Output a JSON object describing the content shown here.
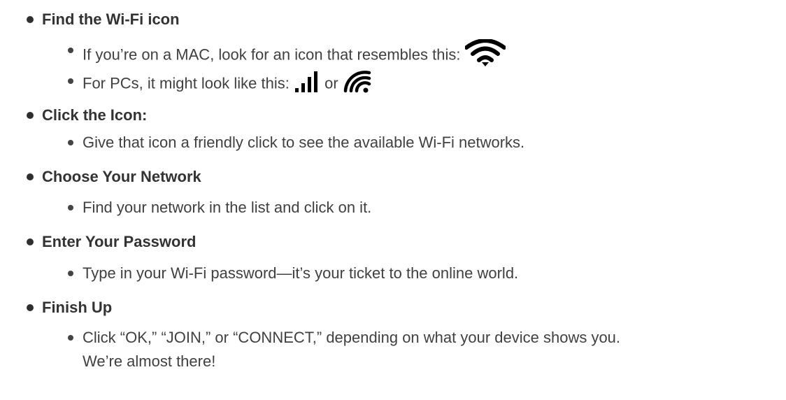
{
  "items": [
    {
      "heading": "Find the Wi-Fi icon",
      "sub": [
        {
          "text": "If you’re on a MAC, look for an icon that resembles this:",
          "icon": "wifi-mac-icon"
        },
        {
          "text": "For PCs, it might look like this:",
          "icon": "signal-bars-icon",
          "connector": "or",
          "icon2": "wifi-pc-icon"
        }
      ]
    },
    {
      "heading": "Click the Icon:",
      "sub": [
        {
          "text": "Give that icon a friendly click to see the available Wi-Fi networks."
        }
      ]
    },
    {
      "heading": "Choose Your Network",
      "sub": [
        {
          "text": "Find your network in the list and click on it."
        }
      ]
    },
    {
      "heading": "Enter Your Password",
      "sub": [
        {
          "text": "Type in your Wi-Fi password—it’s your ticket to the online world."
        }
      ]
    },
    {
      "heading": "Finish Up",
      "sub": [
        {
          "text": "Click “OK,” “JOIN,” or “CONNECT,” depending on what your device shows you."
        },
        {
          "text": "We’re almost there!"
        }
      ]
    }
  ],
  "colors": {
    "text": "#3a3a3a",
    "heading": "#333333",
    "icon": "#000000"
  }
}
